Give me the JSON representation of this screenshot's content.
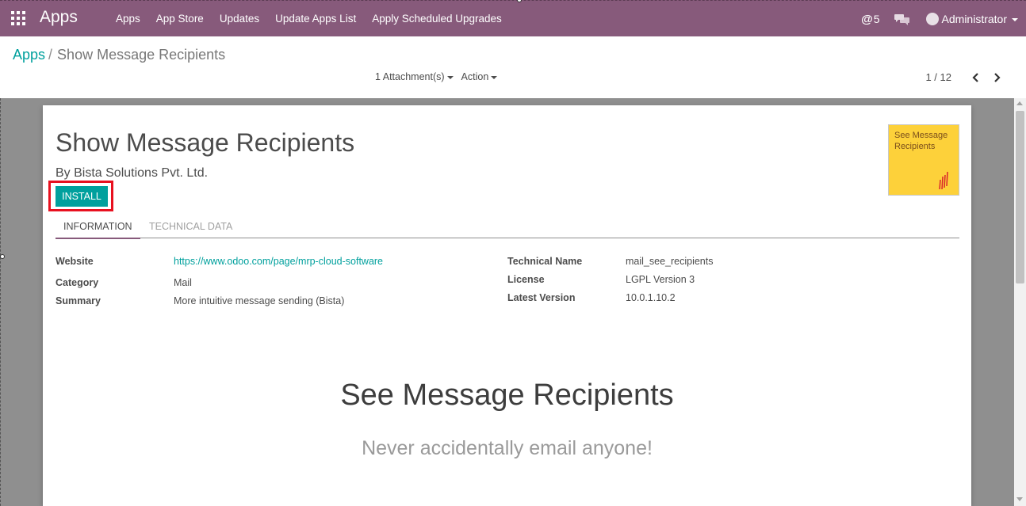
{
  "navbar": {
    "brand": "Apps",
    "menu": [
      "Apps",
      "App Store",
      "Updates",
      "Update Apps List",
      "Apply Scheduled Upgrades"
    ],
    "mentions_count": "5",
    "user_name": "Administrator",
    "bg_color": "#875a7b"
  },
  "breadcrumb": {
    "parent": "Apps",
    "separator": "/",
    "current": "Show Message Recipients"
  },
  "actions": {
    "attachments": "1 Attachment(s)",
    "action": "Action"
  },
  "pager": {
    "value": "1 / 12"
  },
  "module": {
    "title": "Show Message Recipients",
    "author": "By Bista Solutions Pvt. Ltd.",
    "install_label": "INSTALL",
    "thumbnail_text": "See Message Recipients"
  },
  "tabs": {
    "information": "INFORMATION",
    "technical": "TECHNICAL DATA"
  },
  "fields": {
    "website_label": "Website",
    "website_value": "https://www.odoo.com/page/mrp-cloud-software",
    "category_label": "Category",
    "category_value": "Mail",
    "summary_label": "Summary",
    "summary_value": "More intuitive message sending (Bista)",
    "technical_name_label": "Technical Name",
    "technical_name_value": "mail_see_recipients",
    "license_label": "License",
    "license_value": "LGPL Version 3",
    "latest_version_label": "Latest Version",
    "latest_version_value": "10.0.1.10.2"
  },
  "description": {
    "heading": "See Message Recipients",
    "subheading": "Never accidentally email anyone!"
  },
  "icons": {
    "apps_menu": "grid-icon",
    "mention": "at-icon",
    "chat": "chat-bubbles-icon",
    "pager_prev": "chevron-left-icon",
    "pager_next": "chevron-right-icon"
  },
  "colors": {
    "accent": "#00a09d",
    "highlight": "#e8101f",
    "thumbnail": "#fdd13a"
  }
}
